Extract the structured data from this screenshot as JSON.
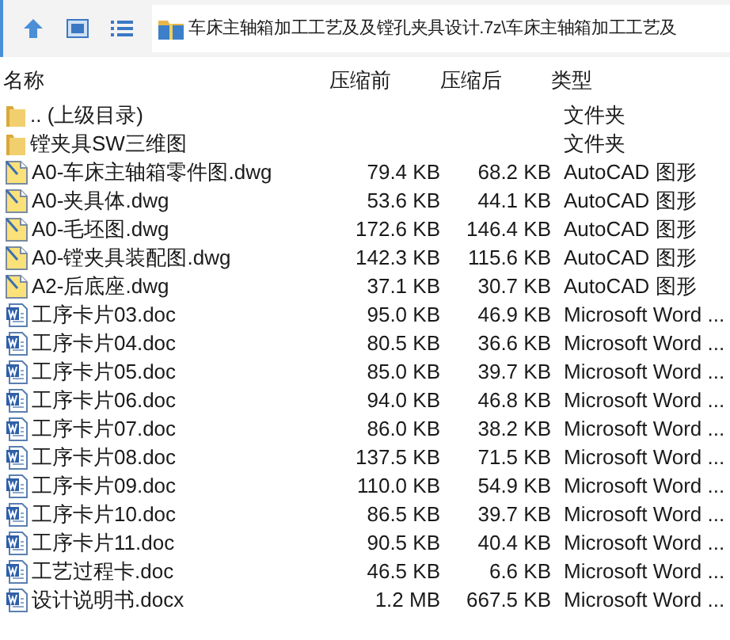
{
  "address_bar": {
    "path": "车床主轴箱加工工艺及及镗孔夹具设计.7z\\车床主轴箱加工工艺及"
  },
  "table": {
    "columns": [
      "名称",
      "压缩前",
      "压缩后",
      "类型"
    ],
    "rows": [
      {
        "kind": "folder",
        "name": ".. (上级目录)",
        "size": "",
        "packed": "",
        "type": "文件夹"
      },
      {
        "kind": "folder",
        "name": "镗夹具SW三维图",
        "size": "",
        "packed": "",
        "type": "文件夹"
      },
      {
        "kind": "dwg",
        "name": "A0-车床主轴箱零件图.dwg",
        "size": "79.4 KB",
        "packed": "68.2 KB",
        "type": "AutoCAD 图形"
      },
      {
        "kind": "dwg",
        "name": "A0-夹具体.dwg",
        "size": "53.6 KB",
        "packed": "44.1 KB",
        "type": "AutoCAD 图形"
      },
      {
        "kind": "dwg",
        "name": "A0-毛坯图.dwg",
        "size": "172.6 KB",
        "packed": "146.4 KB",
        "type": "AutoCAD 图形"
      },
      {
        "kind": "dwg",
        "name": "A0-镗夹具装配图.dwg",
        "size": "142.3 KB",
        "packed": "115.6 KB",
        "type": "AutoCAD 图形"
      },
      {
        "kind": "dwg",
        "name": "A2-后底座.dwg",
        "size": "37.1 KB",
        "packed": "30.7 KB",
        "type": "AutoCAD 图形"
      },
      {
        "kind": "doc",
        "name": "工序卡片03.doc",
        "size": "95.0 KB",
        "packed": "46.9 KB",
        "type": "Microsoft Word ..."
      },
      {
        "kind": "doc",
        "name": "工序卡片04.doc",
        "size": "80.5 KB",
        "packed": "36.6 KB",
        "type": "Microsoft Word ..."
      },
      {
        "kind": "doc",
        "name": "工序卡片05.doc",
        "size": "85.0 KB",
        "packed": "39.7 KB",
        "type": "Microsoft Word ..."
      },
      {
        "kind": "doc",
        "name": "工序卡片06.doc",
        "size": "94.0 KB",
        "packed": "46.8 KB",
        "type": "Microsoft Word ..."
      },
      {
        "kind": "doc",
        "name": "工序卡片07.doc",
        "size": "86.0 KB",
        "packed": "38.2 KB",
        "type": "Microsoft Word ..."
      },
      {
        "kind": "doc",
        "name": "工序卡片08.doc",
        "size": "137.5 KB",
        "packed": "71.5 KB",
        "type": "Microsoft Word ..."
      },
      {
        "kind": "doc",
        "name": "工序卡片09.doc",
        "size": "110.0 KB",
        "packed": "54.9 KB",
        "type": "Microsoft Word ..."
      },
      {
        "kind": "doc",
        "name": "工序卡片10.doc",
        "size": "86.5 KB",
        "packed": "39.7 KB",
        "type": "Microsoft Word ..."
      },
      {
        "kind": "doc",
        "name": "工序卡片11.doc",
        "size": "90.5 KB",
        "packed": "40.4 KB",
        "type": "Microsoft Word ..."
      },
      {
        "kind": "doc",
        "name": "工艺过程卡.doc",
        "size": "46.5 KB",
        "packed": "6.6 KB",
        "type": "Microsoft Word ..."
      },
      {
        "kind": "doc",
        "name": "设计说明书.docx",
        "size": "1.2 MB",
        "packed": "667.5 KB",
        "type": "Microsoft Word ..."
      }
    ]
  }
}
